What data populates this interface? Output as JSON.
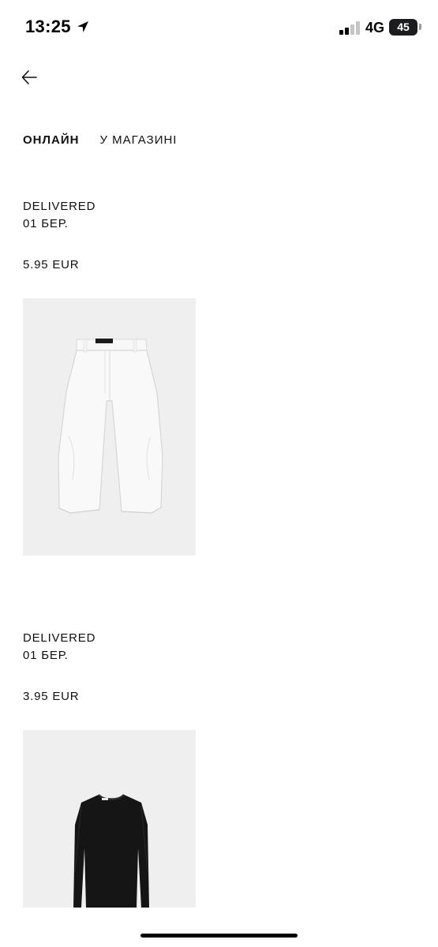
{
  "status_bar": {
    "time": "13:25",
    "network": "4G",
    "battery": "45",
    "signal_level": 0.5
  },
  "nav": {
    "back_icon": "arrow-left-icon"
  },
  "tabs": [
    {
      "label": "ОНЛАЙН",
      "active": true
    },
    {
      "label": "У МАГАЗИНІ",
      "active": false
    }
  ],
  "orders": [
    {
      "status": "DELIVERED",
      "date": "01 БЕР.",
      "price": "5.95 EUR",
      "product_icon": "white-trousers-image"
    },
    {
      "status": "DELIVERED",
      "date": "01 БЕР.",
      "price": "3.95 EUR",
      "product_icon": "black-long-sleeve-top-image"
    }
  ],
  "colors": {
    "background": "#ffffff",
    "text": "#111111",
    "image_bg": "#eeeeee"
  }
}
